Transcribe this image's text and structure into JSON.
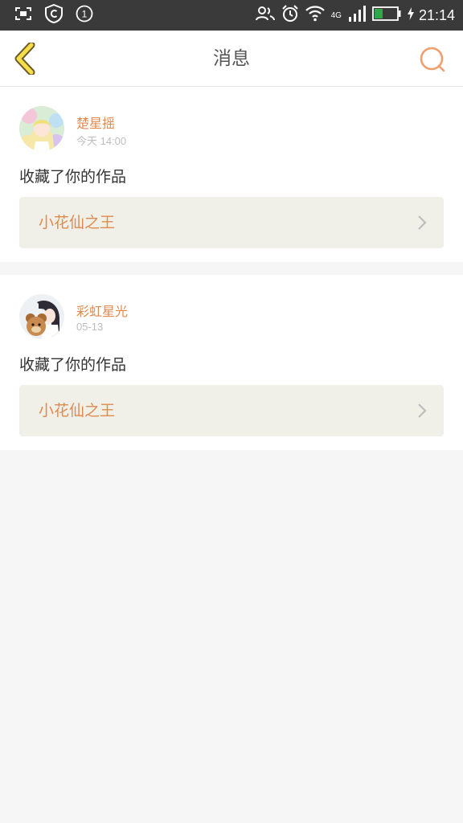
{
  "status_bar": {
    "time": "21:14",
    "network": "4G",
    "notification_count": "1",
    "icons": [
      "screenshot-icon",
      "c-app-icon",
      "notification-count-icon",
      "contacts-icon",
      "alarm-icon",
      "wifi-icon",
      "signal-icon",
      "battery-icon",
      "charging-icon"
    ],
    "battery_color": "#2ea84a"
  },
  "header": {
    "title": "消息",
    "back_icon": "chevron-left-icon",
    "search_icon": "search-icon",
    "accent_color": "#e08a4f"
  },
  "messages": [
    {
      "username": "楚星摇",
      "time": "今天 14:00",
      "action": "收藏了你的作品",
      "work_title": "小花仙之王"
    },
    {
      "username": "彩虹星光",
      "time": "05-13",
      "action": "收藏了你的作品",
      "work_title": "小花仙之王"
    }
  ]
}
